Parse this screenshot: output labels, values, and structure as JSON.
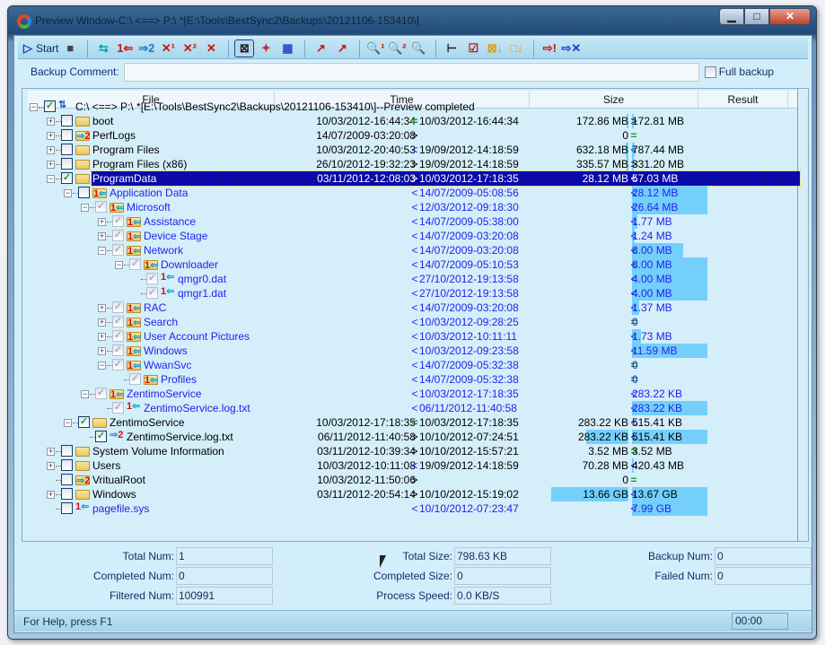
{
  "window": {
    "title": "Preview Window-C:\\ <==> P:\\ *[E:\\Tools\\BestSync2\\Backups\\20121106-153410\\]",
    "minimize": "▁",
    "maximize": "□",
    "close": "✕"
  },
  "toolbar": {
    "start_label": "Start",
    "buttons": [
      {
        "icon": "start-icon",
        "glyph": "▷",
        "color": "#1a3acc"
      },
      {
        "icon": "stop-icon",
        "glyph": "■",
        "color": "#444"
      },
      {
        "sep": true
      },
      {
        "icon": "sync-both-icon",
        "glyph": "⇆",
        "color": "#0aa"
      },
      {
        "icon": "copy-to-1-icon",
        "glyph": "1⇐",
        "color": "#d01010"
      },
      {
        "icon": "copy-to-2-icon",
        "glyph": "⇒2",
        "color": "#1a7acc"
      },
      {
        "icon": "delete-1-icon",
        "glyph": "✕¹",
        "color": "#d01010"
      },
      {
        "icon": "delete-2-icon",
        "glyph": "✕²",
        "color": "#d01010"
      },
      {
        "icon": "delete-icon",
        "glyph": "✕",
        "color": "#d01010"
      },
      {
        "sep": true
      },
      {
        "icon": "view-filter-icon",
        "glyph": "⊠",
        "color": "#222",
        "active": true
      },
      {
        "icon": "view-new-icon",
        "glyph": "✦",
        "color": "#c03030"
      },
      {
        "icon": "view-changed-icon",
        "glyph": "▦",
        "color": "#2a4acc"
      },
      {
        "sep": true
      },
      {
        "icon": "mark-icon",
        "glyph": "↗",
        "color": "#d01010"
      },
      {
        "icon": "mark-file-icon",
        "glyph": "↗",
        "color": "#d01010"
      },
      {
        "sep": true
      },
      {
        "icon": "find-1-icon",
        "glyph": "🔍¹",
        "color": "#d01010"
      },
      {
        "icon": "find-2-icon",
        "glyph": "🔍²",
        "color": "#d01010"
      },
      {
        "icon": "find-doc-icon",
        "glyph": "🔍",
        "color": "#444"
      },
      {
        "sep": true
      },
      {
        "icon": "tree-icon",
        "glyph": "⊢",
        "color": "#222"
      },
      {
        "icon": "check-all-icon",
        "glyph": "☑",
        "color": "#d01010"
      },
      {
        "icon": "check-down-icon",
        "glyph": "⊠↓",
        "color": "#e0a000"
      },
      {
        "icon": "uncheck-down-icon",
        "glyph": "□↓",
        "color": "#e0a000"
      },
      {
        "sep": true
      },
      {
        "icon": "error-icon",
        "glyph": "⇨!",
        "color": "#d01010"
      },
      {
        "icon": "cancel-icon",
        "glyph": "⇨✕",
        "color": "#1a3acc"
      }
    ]
  },
  "comment": {
    "label": "Backup Comment:",
    "value": "",
    "full_backup_label": "Full backup",
    "full_backup_checked": false
  },
  "columns": [
    "File",
    "Time",
    "Size",
    "Result"
  ],
  "rows": [
    {
      "level": 0,
      "exp": "-",
      "chk": "checked",
      "icon": "sync",
      "name": "C:\\ <==> P:\\ *[E:\\Tools\\BestSync2\\Backups\\20121106-153410\\]--Preview completed",
      "color": "black"
    },
    {
      "level": 1,
      "exp": "+",
      "chk": "unchecked",
      "icon": "folder",
      "name": "boot",
      "tl": "10/03/2012-16:44:34",
      "ct": "=",
      "tr": "10/03/2012-16:44:34",
      "sl": "172.86 MB",
      "cs": ">",
      "sr": "172.81 MB",
      "color": "black",
      "bl": 0.02,
      "br": 0.01
    },
    {
      "level": 1,
      "exp": "+",
      "chk": "unchecked",
      "icon": "folder-right2",
      "name": "PerfLogs",
      "tl": "14/07/2009-03:20:08",
      "ct": ">",
      "sl": "0",
      "cs": "=",
      "color": "black"
    },
    {
      "level": 1,
      "exp": "+",
      "chk": "unchecked",
      "icon": "folder",
      "name": "Program Files",
      "tl": "10/03/2012-20:40:53",
      "ct": "<",
      "tr": "19/09/2012-14:18:59",
      "sl": "632.18 MB",
      "cs": "<",
      "sr": "787.44 MB",
      "color": "black",
      "bl": 0.03,
      "br": 0.03
    },
    {
      "level": 1,
      "exp": "+",
      "chk": "unchecked",
      "icon": "folder",
      "name": "Program Files (x86)",
      "tl": "26/10/2012-19:32:23",
      "ct": ">",
      "tr": "19/09/2012-14:18:59",
      "sl": "335.57 MB",
      "cs": ">",
      "sr": "331.20 MB",
      "color": "black",
      "bl": 0.01,
      "br": 0.01
    },
    {
      "level": 1,
      "exp": "-",
      "chk": "checked",
      "icon": "folder",
      "name": "ProgramData",
      "tl": "03/11/2012-12:08:03",
      "ct": ">",
      "tr": "10/03/2012-17:18:35",
      "sl": "28.12 MB",
      "cs": "<",
      "sr": "57.03 MB",
      "color": "black",
      "selected": true
    },
    {
      "level": 2,
      "exp": "-",
      "chk": "unchecked",
      "icon": "folder-left",
      "name": "Application Data",
      "ct": "<",
      "tr": "14/07/2009-05:08:56",
      "cs": "<",
      "sr": "28.12 MB",
      "color": "blue",
      "br": 1.0
    },
    {
      "level": 3,
      "exp": "-",
      "chk": "gray",
      "icon": "folder-left",
      "name": "Microsoft",
      "ct": "<",
      "tr": "12/03/2012-09:18:30",
      "cs": "<",
      "sr": "26.64 MB",
      "color": "blue",
      "br": 1.0
    },
    {
      "level": 4,
      "exp": "+",
      "chk": "gray",
      "icon": "folder-left",
      "name": "Assistance",
      "ct": "<",
      "tr": "14/07/2009-05:38:00",
      "cs": "<",
      "sr": "1.77 MB",
      "color": "blue",
      "br": 0.07
    },
    {
      "level": 4,
      "exp": "+",
      "chk": "gray",
      "icon": "folder-left",
      "name": "Device Stage",
      "ct": "<",
      "tr": "14/07/2009-03:20:08",
      "cs": "<",
      "sr": "1.24 MB",
      "color": "blue",
      "br": 0.03
    },
    {
      "level": 4,
      "exp": "-",
      "chk": "gray",
      "icon": "folder-left",
      "name": "Network",
      "ct": "<",
      "tr": "14/07/2009-03:20:08",
      "cs": "<",
      "sr": "8.00 MB",
      "color": "blue",
      "br": 0.68
    },
    {
      "level": 5,
      "exp": "-",
      "chk": "gray",
      "icon": "folder-left",
      "name": "Downloader",
      "ct": "<",
      "tr": "14/07/2009-05:10:53",
      "cs": "<",
      "sr": "8.00 MB",
      "color": "blue",
      "br": 1.0
    },
    {
      "level": 6,
      "exp": "",
      "chk": "gray",
      "icon": "file-left",
      "name": "qmgr0.dat",
      "ct": "<",
      "tr": "27/10/2012-19:13:58",
      "cs": "<",
      "sr": "4.00 MB",
      "color": "blue",
      "br": 1.0,
      "res": true
    },
    {
      "level": 6,
      "exp": "",
      "chk": "gray",
      "icon": "file-left",
      "name": "qmgr1.dat",
      "ct": "<",
      "tr": "27/10/2012-19:13:58",
      "cs": "<",
      "sr": "4.00 MB",
      "color": "blue",
      "br": 1.0,
      "res": true
    },
    {
      "level": 4,
      "exp": "+",
      "chk": "gray",
      "icon": "folder-left",
      "name": "RAC",
      "ct": "<",
      "tr": "14/07/2009-03:20:08",
      "cs": "<",
      "sr": "1.37 MB",
      "color": "blue",
      "br": 0.1
    },
    {
      "level": 4,
      "exp": "+",
      "chk": "gray",
      "icon": "folder-left",
      "name": "Search",
      "ct": "<",
      "tr": "10/03/2012-09:28:25",
      "cs": "=",
      "sr": "0",
      "color": "blue"
    },
    {
      "level": 4,
      "exp": "+",
      "chk": "gray",
      "icon": "folder-left",
      "name": "User Account Pictures",
      "ct": "<",
      "tr": "10/03/2012-10:11:11",
      "cs": "<",
      "sr": "1.73 MB",
      "color": "blue",
      "br": 0.12
    },
    {
      "level": 4,
      "exp": "+",
      "chk": "gray",
      "icon": "folder-left",
      "name": "Windows",
      "ct": "<",
      "tr": "10/03/2012-09:23:58",
      "cs": "<",
      "sr": "11.59 MB",
      "color": "blue",
      "br": 1.0
    },
    {
      "level": 4,
      "exp": "-",
      "chk": "gray",
      "icon": "folder-left",
      "name": "WwanSvc",
      "ct": "<",
      "tr": "14/07/2009-05:32:38",
      "cs": "=",
      "sr": "0",
      "color": "blue"
    },
    {
      "level": 5,
      "exp": "",
      "chk": "gray",
      "icon": "folder-left",
      "name": "Profiles",
      "ct": "<",
      "tr": "14/07/2009-05:32:38",
      "cs": "=",
      "sr": "0",
      "color": "blue"
    },
    {
      "level": 3,
      "exp": "-",
      "chk": "gray",
      "icon": "folder-left",
      "name": "ZentimoService",
      "ct": "<",
      "tr": "10/03/2012-17:18:35",
      "cs": "<",
      "sr": "283.22 KB",
      "color": "blue"
    },
    {
      "level": 4,
      "exp": "",
      "chk": "gray",
      "icon": "file-left",
      "name": "ZentimoService.log.txt",
      "ct": "<",
      "tr": "06/11/2012-11:40:58",
      "cs": "<",
      "sr": "283.22 KB",
      "color": "blue",
      "br": 1.0,
      "res": true
    },
    {
      "level": 2,
      "exp": "-",
      "chk": "checked",
      "icon": "folder",
      "name": "ZentimoService",
      "tl": "10/03/2012-17:18:35",
      "ct": "=",
      "tr": "10/03/2012-17:18:35",
      "sl": "283.22 KB",
      "cs": "<",
      "sr": "515.41 KB",
      "color": "black"
    },
    {
      "level": 3,
      "exp": "",
      "chk": "checked",
      "icon": "file-right2",
      "name": "ZentimoService.log.txt",
      "tl": "06/11/2012-11:40:58",
      "ct": ">",
      "tr": "10/10/2012-07:24:51",
      "sl": "283.22 KB",
      "cs": "<",
      "sr": "515.41 KB",
      "color": "black",
      "bl": 0.55,
      "br": 1.0,
      "res": true
    },
    {
      "level": 1,
      "exp": "+",
      "chk": "unchecked",
      "icon": "folder",
      "name": "System Volume Information",
      "tl": "03/11/2012-10:39:34",
      "ct": ">",
      "tr": "10/10/2012-15:57:21",
      "sl": "3.52 MB",
      "cs": "=",
      "sr": "3.52 MB",
      "color": "black"
    },
    {
      "level": 1,
      "exp": "+",
      "chk": "unchecked",
      "icon": "folder",
      "name": "Users",
      "tl": "10/03/2012-10:11:08",
      "ct": "<",
      "tr": "19/09/2012-14:18:59",
      "sl": "70.28 MB",
      "cs": "<",
      "sr": "420.43 MB",
      "color": "black",
      "br": 0.02
    },
    {
      "level": 1,
      "exp": "",
      "chk": "unchecked",
      "icon": "folder-right2",
      "name": "VritualRoot",
      "tl": "10/03/2012-11:50:06",
      "ct": ">",
      "sl": "0",
      "cs": "=",
      "color": "black"
    },
    {
      "level": 1,
      "exp": "+",
      "chk": "unchecked",
      "icon": "folder",
      "name": "Windows",
      "tl": "03/11/2012-20:54:14",
      "ct": ">",
      "tr": "10/10/2012-15:19:02",
      "sl": "13.66 GB",
      "cs": "<",
      "sr": "13.67 GB",
      "color": "black",
      "bl": 1.0,
      "br": 1.0
    },
    {
      "level": 1,
      "exp": "",
      "chk": "unchecked",
      "icon": "file-left",
      "name": "pagefile.sys",
      "ct": "<",
      "tr": "10/10/2012-07:23:47",
      "cs": "<",
      "sr": "7.99 GB",
      "color": "blue",
      "br": 1.0,
      "res": true
    }
  ],
  "stats": {
    "total_num": {
      "label": "Total Num:",
      "value": "1"
    },
    "completed_num": {
      "label": "Completed Num:",
      "value": "0"
    },
    "filtered_num": {
      "label": "Filtered Num:",
      "value": "100991"
    },
    "total_size": {
      "label": "Total Size:",
      "value": "798.63 KB"
    },
    "completed_size": {
      "label": "Completed Size:",
      "value": "0"
    },
    "process_speed": {
      "label": "Process Speed:",
      "value": "0.0 KB/S"
    },
    "backup_num": {
      "label": "Backup Num:",
      "value": "0"
    },
    "failed_num": {
      "label": "Failed Num:",
      "value": "0"
    }
  },
  "status": {
    "help": "For Help, press F1",
    "elapsed": "00:00"
  },
  "colors": {
    "selection": "#0a0aa8",
    "bar": "#74d0fb",
    "blue_text": "#2222ee",
    "equal": "#1a9a1a"
  }
}
